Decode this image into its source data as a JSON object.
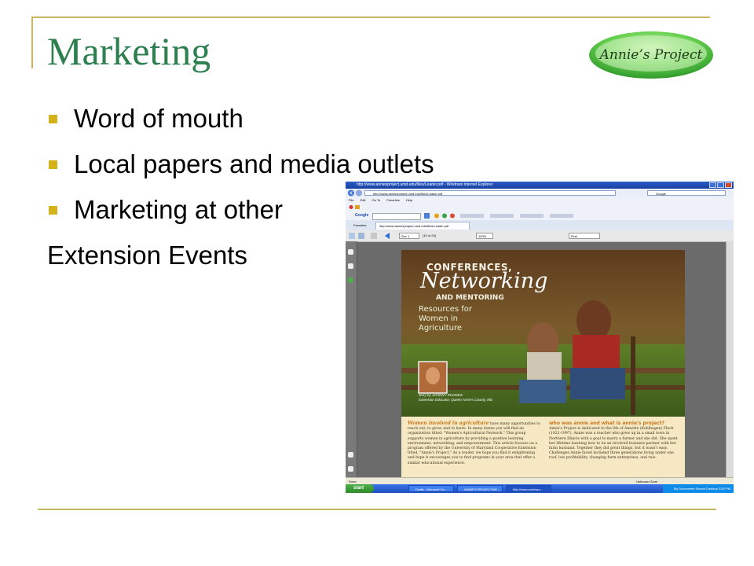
{
  "slide": {
    "title": "Marketing",
    "logo_text": "Annie’s Project",
    "bullets": [
      "Word of mouth",
      "Local papers and media outlets",
      "Marketing at other"
    ],
    "continuation": "Extension Events"
  },
  "screenshot": {
    "window_title": "http://www.anniesproject.umd.edu/files/Leader.pdf - Windows Internet Explorer",
    "address": "http://www.anniesproject.umd.edu/files/Leader.pdf",
    "search_placeholder": "Google",
    "menu": [
      "File",
      "Edit",
      "Go To",
      "Favorites",
      "Help"
    ],
    "google_label": "Google",
    "favorites_label": "Favorites",
    "tab_label": "http://www.anniesproject.umd.edu/files/Leader.pdf",
    "page_field": "Sec 1",
    "page_count": "(10 of 24)",
    "zoom": "100%",
    "find_placeholder": "Find",
    "status_left": "Done",
    "status_right": "Unknown Zone",
    "start_label": "start",
    "tasks": [
      "Drafts - Microsoft Ou...",
      "ANNIE'S PROJECT\\NE...",
      "http://www.anniespr..."
    ],
    "tray": "My Documents   Search Desktop   3:52 PM",
    "document": {
      "heading_1": "CONFERENCES,",
      "heading_2": "Networking",
      "heading_3": "AND MENTORING",
      "subheading": "Resources for Women in Agriculture",
      "byline": "story by JOHNNY RHODES",
      "byline_role": "Extension Educator, Queen Anne's County, MD",
      "lead_title": "Women involved in agriculture",
      "lead_text": "have many opportunities to reach out, to grow, and to learn. In many states you will find an organization titled: \"Women's Agricultural Network.\" This group supports women in agriculture by providing a positive learning environment, networking, and empowerment. This article focuses on a program offered by the University of Maryland Cooperative Extension titled, \"Annie's Project.\" As a reader, we hope you find it enlightening and hope it encourages you to find programs in your area that offer a similar educational experience.",
      "right_title": "who was annie and what is annie's project?",
      "right_text": "Annie's Project is dedicated to the life of Annette (Kohlhagen) Fleck (1922-1997). Annie was a teacher who grew up in a small town in Northern Illinois with a goal to marry a farmer and she did. She spent her lifetime learning how to be an involved business partner with her farm husband. Together they did great things, but it wasn't easy. Challenges Annie faced included three generations living under one roof, low profitability, changing farm enterprises, and rais-"
    }
  },
  "colors": {
    "title": "#2e7f4f",
    "bullet": "#d4b21a",
    "frame": "#c8b660",
    "logo_green": "#5cc94a"
  }
}
